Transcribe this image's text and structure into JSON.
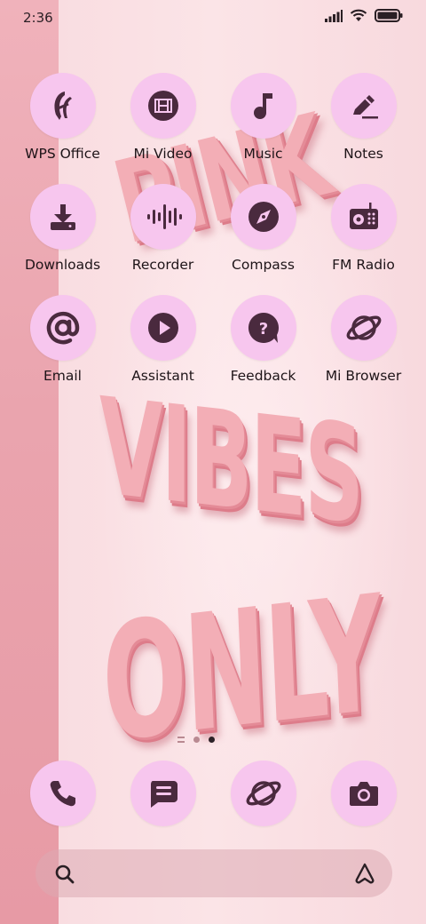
{
  "status": {
    "time": "2:36",
    "signal_icon": "signal-icon",
    "wifi_icon": "wifi-icon",
    "battery_icon": "battery-icon"
  },
  "wallpaper": {
    "words": [
      "PINK",
      "VIBES",
      "ONLY"
    ]
  },
  "apps": [
    {
      "label": "WPS Office",
      "icon": "wps-office-icon"
    },
    {
      "label": "Mi Video",
      "icon": "film-icon"
    },
    {
      "label": "Music",
      "icon": "music-note-icon"
    },
    {
      "label": "Notes",
      "icon": "pencil-icon"
    },
    {
      "label": "Downloads",
      "icon": "download-icon"
    },
    {
      "label": "Recorder",
      "icon": "waveform-icon"
    },
    {
      "label": "Compass",
      "icon": "compass-icon"
    },
    {
      "label": "FM Radio",
      "icon": "radio-icon"
    },
    {
      "label": "Email",
      "icon": "at-sign-icon"
    },
    {
      "label": "Assistant",
      "icon": "play-icon"
    },
    {
      "label": "Feedback",
      "icon": "question-bubble-icon"
    },
    {
      "label": "Mi Browser",
      "icon": "planet-icon"
    }
  ],
  "page_indicator": {
    "current": 2,
    "total": 2
  },
  "dock": [
    {
      "icon": "phone-icon"
    },
    {
      "icon": "message-icon"
    },
    {
      "icon": "planet-icon"
    },
    {
      "icon": "camera-icon"
    }
  ],
  "search": {
    "search_icon": "search-icon",
    "assistant_icon": "assistant-logo-icon"
  },
  "colors": {
    "icon_bg": "#f7c6ee",
    "glyph": "#4a2a3e",
    "label": "#1e1418"
  }
}
